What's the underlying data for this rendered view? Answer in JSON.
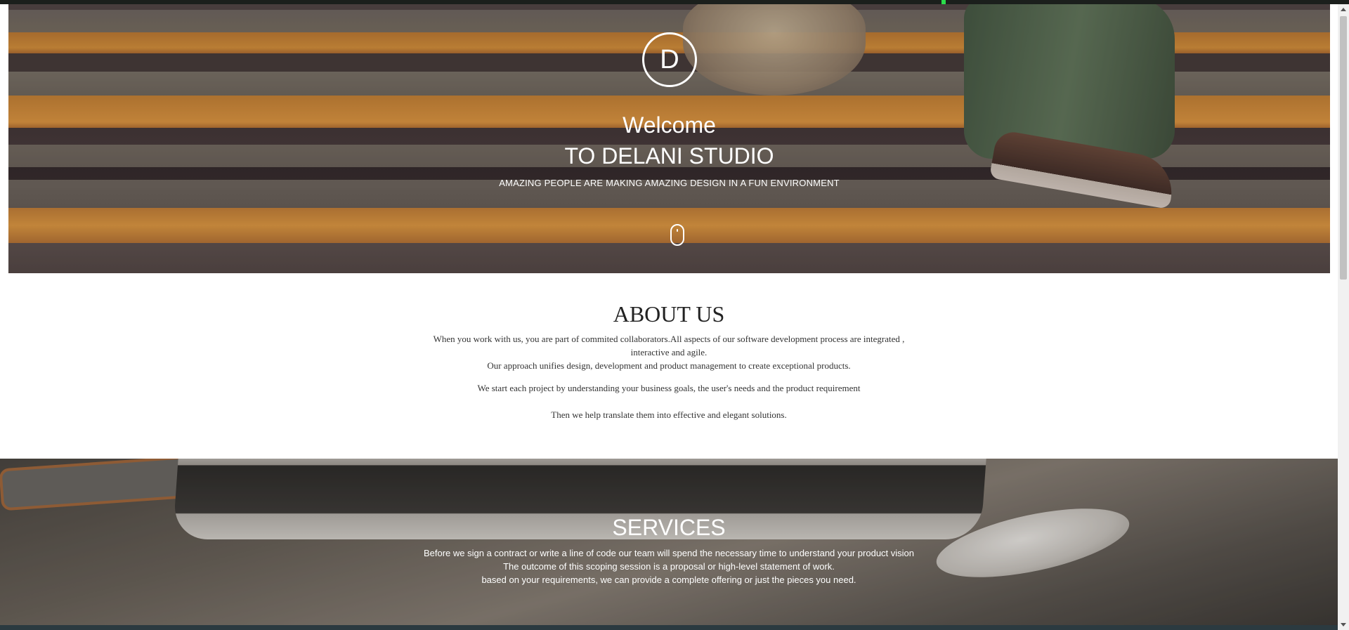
{
  "hero": {
    "logo_letter": "D",
    "welcome": "Welcome",
    "studio": "TO DELANI STUDIO",
    "tagline": "AMAZING PEOPLE ARE MAKING AMAZING DESIGN IN A FUN ENVIRONMENT",
    "scroll_icon": "mouse-icon"
  },
  "about": {
    "title": "ABOUT US",
    "paragraphs": [
      "When you work with us, you are part of commited collaborators.All aspects of our software development process are integrated , interactive and agile.",
      "Our approach unifies design, development and product management to create exceptional products.",
      "We start each project by understanding your business goals, the user's needs and the product requirement",
      "Then we help translate them into effective and elegant solutions."
    ]
  },
  "services": {
    "title": "SERVICES",
    "lines": [
      "Before we sign a contract or write a line of code our team will spend the necessary time to understand your product vision",
      "The outcome of this scoping session is a proposal or high-level statement of work.",
      "based on your requirements, we can provide a complete offering or just the pieces you need."
    ]
  },
  "colors": {
    "hero_text": "#ffffff",
    "about_text": "#333333",
    "stripe_orange": "#e39a34"
  }
}
